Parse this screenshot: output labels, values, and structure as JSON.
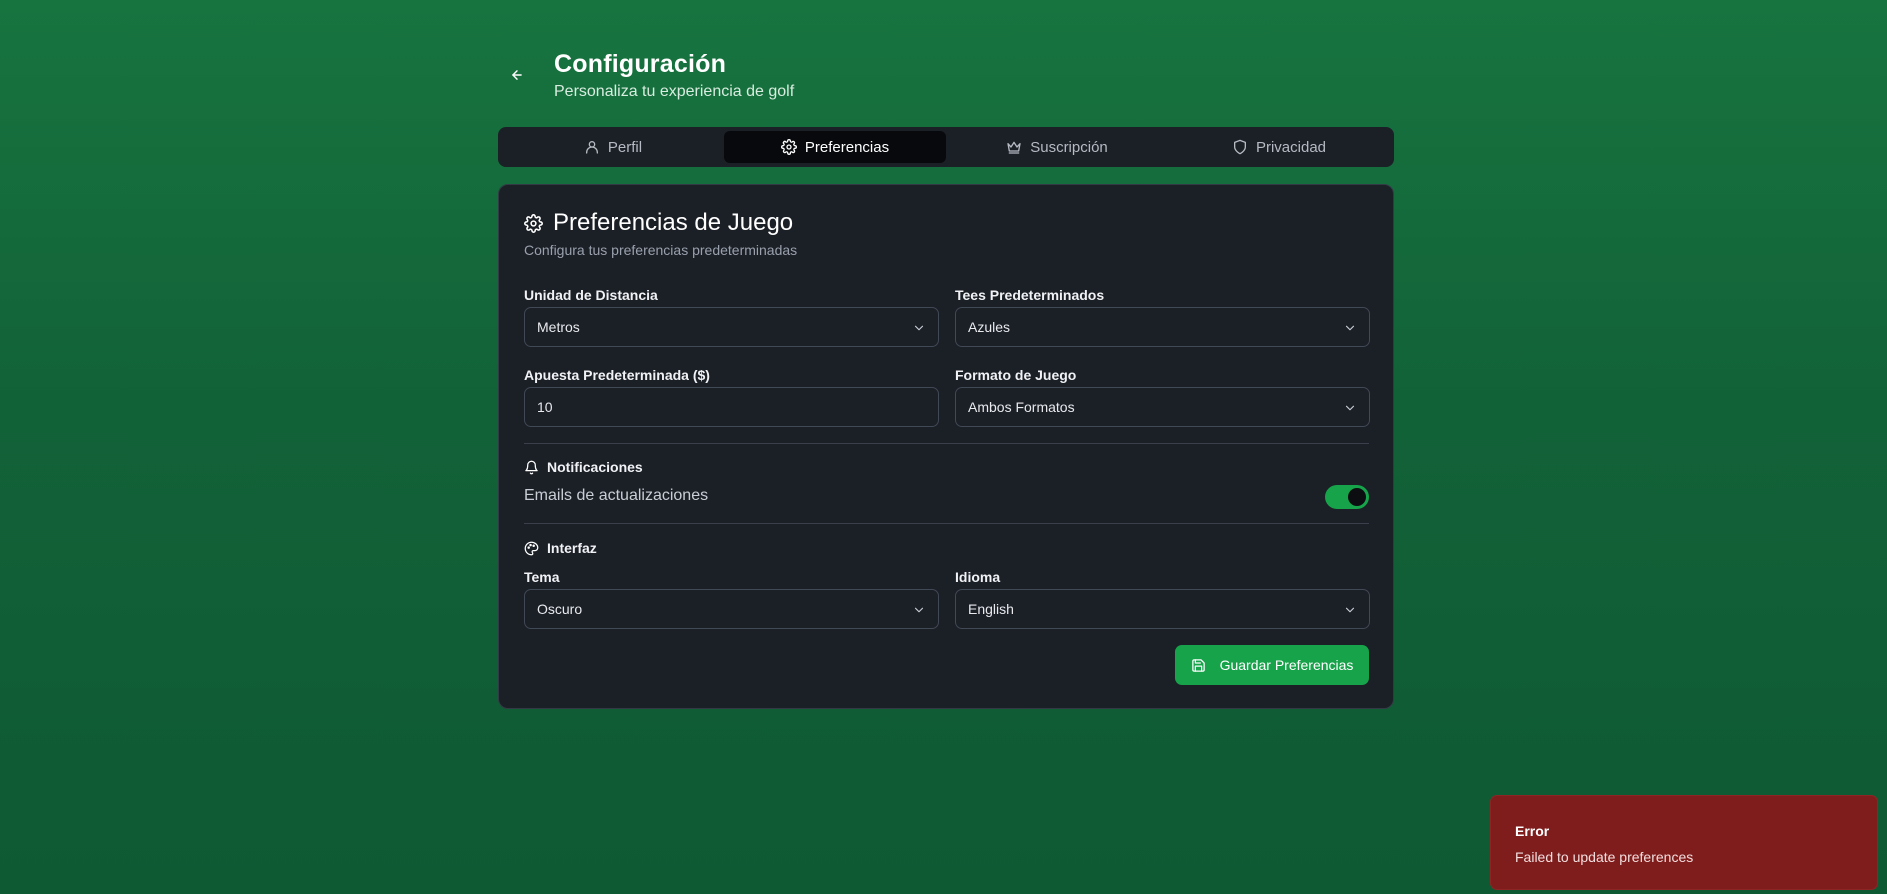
{
  "header": {
    "title": "Configuración",
    "subtitle": "Personaliza tu experiencia de golf"
  },
  "tabs": [
    {
      "label": "Perfil",
      "icon": "user-icon",
      "active": false
    },
    {
      "label": "Preferencias",
      "icon": "gear-icon",
      "active": true
    },
    {
      "label": "Suscripción",
      "icon": "crown-icon",
      "active": false
    },
    {
      "label": "Privacidad",
      "icon": "shield-icon",
      "active": false
    }
  ],
  "card": {
    "title": "Preferencias de Juego",
    "description": "Configura tus preferencias predeterminadas"
  },
  "fields": {
    "distance_unit": {
      "label": "Unidad de Distancia",
      "value": "Metros"
    },
    "default_tees": {
      "label": "Tees Predeterminados",
      "value": "Azules"
    },
    "default_bet": {
      "label": "Apuesta Predeterminada ($)",
      "value": "10"
    },
    "game_format": {
      "label": "Formato de Juego",
      "value": "Ambos Formatos"
    },
    "theme": {
      "label": "Tema",
      "value": "Oscuro"
    },
    "language": {
      "label": "Idioma",
      "value": "English"
    }
  },
  "notifications": {
    "heading": "Notificaciones",
    "email_updates_label": "Emails de actualizaciones",
    "email_updates_enabled": true
  },
  "interface": {
    "heading": "Interfaz"
  },
  "save_button": {
    "label": "Guardar Preferencias"
  },
  "toast": {
    "title": "Error",
    "message": "Failed to update preferences"
  },
  "colors": {
    "accent_green": "#16a34a",
    "card_background": "#1b1f26",
    "error_background": "#7f1d1d"
  }
}
